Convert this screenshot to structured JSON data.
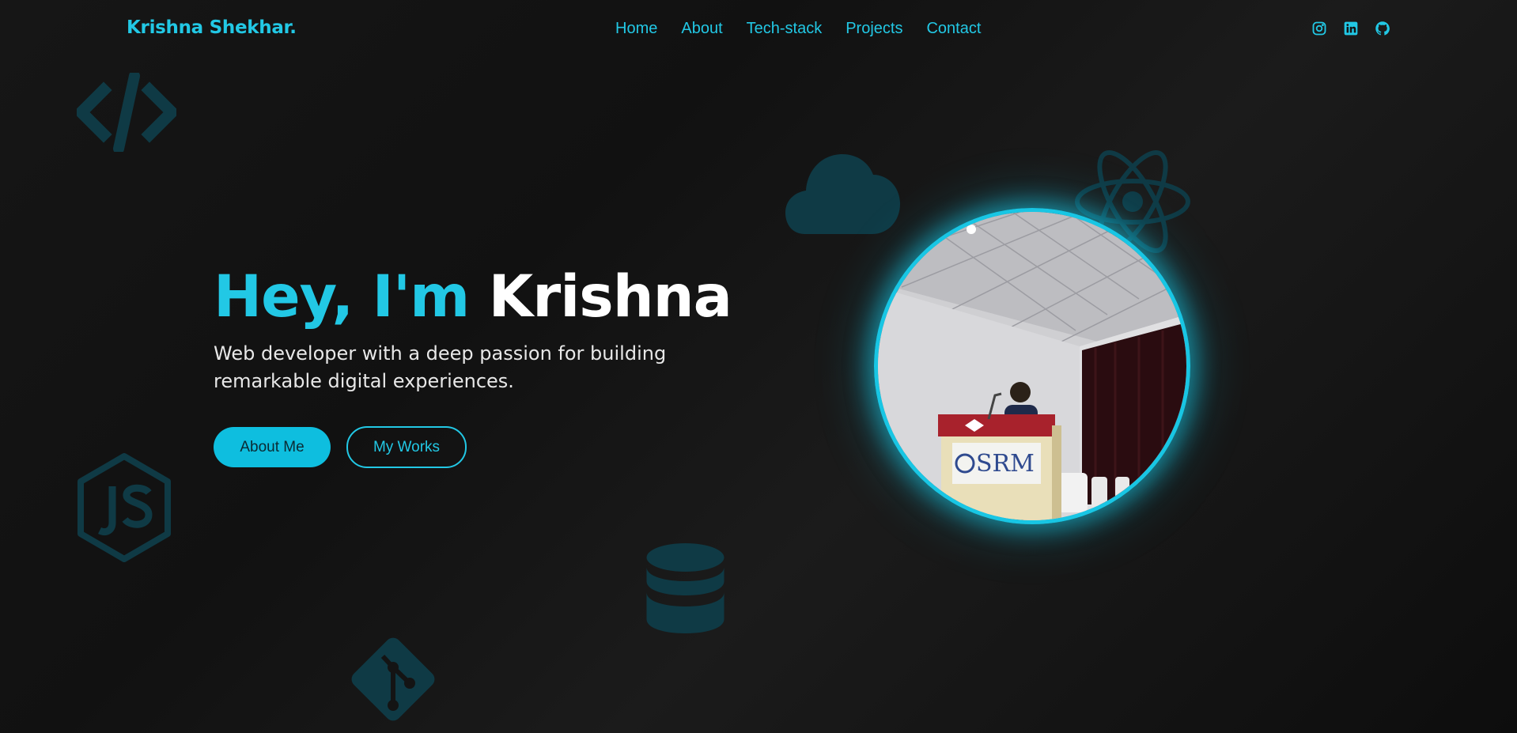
{
  "header": {
    "brand": "Krishna Shekhar.",
    "nav": [
      "Home",
      "About",
      "Tech-stack",
      "Projects",
      "Contact"
    ],
    "socials": [
      "instagram-icon",
      "linkedin-icon",
      "github-icon"
    ]
  },
  "hero": {
    "greeting": "Hey, I'm",
    "name": "Krishna",
    "subtitle": "Web developer with a deep passion for building remarkable digital experiences.",
    "primary_button": "About Me",
    "secondary_button": "My Works"
  },
  "photo": {
    "podium_text": "SRM"
  },
  "background_icons": [
    "code-icon",
    "cloud-icon",
    "react-icon",
    "nodejs-icon",
    "database-icon",
    "git-icon"
  ],
  "colors": {
    "accent": "#22c8e5",
    "background": "#141414",
    "icon_faded": "#0f3a45"
  }
}
